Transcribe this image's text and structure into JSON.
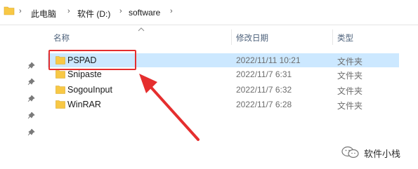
{
  "breadcrumb": {
    "items": [
      "此电脑",
      "软件 (D:)",
      "software"
    ]
  },
  "columns": {
    "name": "名称",
    "date": "修改日期",
    "type": "类型"
  },
  "files": [
    {
      "name": "PSPAD",
      "date": "2022/11/11 10:21",
      "type": "文件夹",
      "selected": true
    },
    {
      "name": "Snipaste",
      "date": "2022/11/7 6:31",
      "type": "文件夹",
      "selected": false
    },
    {
      "name": "SogouInput",
      "date": "2022/11/7 6:32",
      "type": "文件夹",
      "selected": false
    },
    {
      "name": "WinRAR",
      "date": "2022/11/7 6:28",
      "type": "文件夹",
      "selected": false
    }
  ],
  "watermark": {
    "text": "软件小栈"
  },
  "colors": {
    "selection": "#cce8ff",
    "highlight_box": "#e52e2e",
    "folder": "#f8c845"
  },
  "icons": [
    "folder-icon",
    "chevron-right-icon",
    "pin-icon",
    "sort-up-icon",
    "wechat-icon"
  ]
}
